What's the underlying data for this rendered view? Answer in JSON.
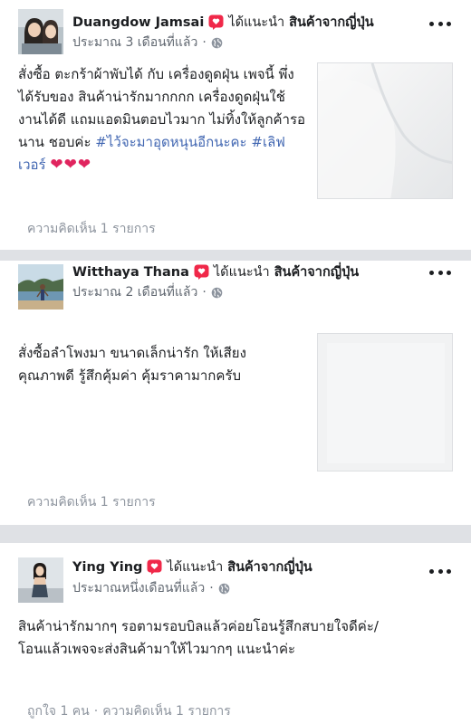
{
  "posts": [
    {
      "author": "Duangdow Jamsai",
      "recommend_text": "ได้แนะนำ",
      "page_name": "สินค้าจากญี่ปุ่น",
      "time": "ประมาณ 3 เดือนที่แล้ว",
      "separator": "·",
      "text_main": "สั่งซื้อ ตะกร้าผ้าพับได้ กับ เครื่องดูดฝุ่น เพจนี้ พึ่งได้รับของ สินค้าน่ารักมากกกก เครื่องดูดฝุ่นใช้งานได้ดี แถมแอดมินตอบไวมาก ไม่ทิ้งให้ลูกค้ารอนาน ชอบค่ะ ",
      "hashtag_1": "#ไว้จะมาอุดหนุนอีกนะคะ",
      "hashtag_2": "#เลิฟเวอร์",
      "hearts": "❤❤❤",
      "footer": "ความคิดเห็น 1 รายการ",
      "icons": {
        "recommend": "recommend-badge-icon",
        "privacy": "globe-icon",
        "menu": "more-options-icon"
      }
    },
    {
      "author": "Witthaya Thana",
      "recommend_text": "ได้แนะนำ",
      "page_name": "สินค้าจากญี่ปุ่น",
      "time": "ประมาณ 2 เดือนที่แล้ว",
      "separator": "·",
      "text_line_1": "สั่งซื้อลำโพงมา ขนาดเล็กน่ารัก ให้เสียง",
      "text_line_2": "คุณภาพดี รู้สึกคุ้มค่า คุ้มราคามากครับ",
      "footer": "ความคิดเห็น 1 รายการ"
    },
    {
      "author": "Ying Ying",
      "recommend_text": "ได้แนะนำ",
      "page_name": "สินค้าจากญี่ปุ่น",
      "time": "ประมาณหนึ่งเดือนที่แล้ว",
      "separator": "·",
      "text_line_1": "สินค้าน่ารักมากๆ รอตามรอบบิลแล้วค่อยโอนรู้สึกสบายใจดีค่ะ/",
      "text_line_2": "โอนแล้วเพจจะส่งสินค้ามาให้ไวมากๆ แนะนำค่ะ",
      "likes": "ถูกใจ 1 คน",
      "footer_separator": "·",
      "footer": "ความคิดเห็น 1 รายการ"
    }
  ],
  "colors": {
    "divider": "#dfe1e5",
    "hashtag": "#4267b2",
    "meta": "#606770",
    "recommend_badge": "#f02849",
    "heart": "#e0245e"
  }
}
